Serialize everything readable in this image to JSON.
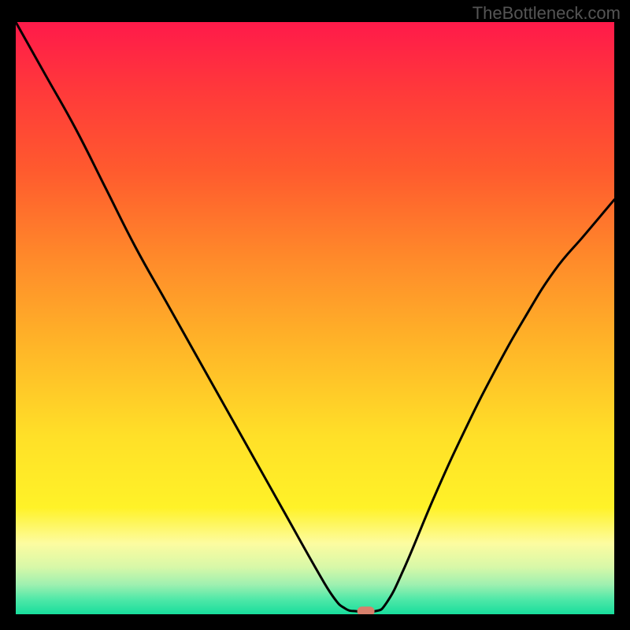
{
  "watermark": "TheBottleneck.com",
  "chart_data": {
    "type": "line",
    "title": "",
    "xlabel": "",
    "ylabel": "",
    "xlim": [
      0,
      100
    ],
    "ylim": [
      0,
      100
    ],
    "curve": [
      {
        "x": 0,
        "y": 100
      },
      {
        "x": 5,
        "y": 91
      },
      {
        "x": 10,
        "y": 82
      },
      {
        "x": 15,
        "y": 72
      },
      {
        "x": 20,
        "y": 62
      },
      {
        "x": 25,
        "y": 53
      },
      {
        "x": 30,
        "y": 44
      },
      {
        "x": 35,
        "y": 35
      },
      {
        "x": 40,
        "y": 26
      },
      {
        "x": 45,
        "y": 17
      },
      {
        "x": 50,
        "y": 8
      },
      {
        "x": 53,
        "y": 3
      },
      {
        "x": 55,
        "y": 1
      },
      {
        "x": 57,
        "y": 0.5
      },
      {
        "x": 60,
        "y": 0.5
      },
      {
        "x": 62,
        "y": 2
      },
      {
        "x": 65,
        "y": 8
      },
      {
        "x": 70,
        "y": 20
      },
      {
        "x": 75,
        "y": 31
      },
      {
        "x": 80,
        "y": 41
      },
      {
        "x": 85,
        "y": 50
      },
      {
        "x": 90,
        "y": 58
      },
      {
        "x": 95,
        "y": 64
      },
      {
        "x": 100,
        "y": 70
      }
    ],
    "marker": {
      "x": 58.5,
      "y": 0.5,
      "color": "#d8806c"
    },
    "gradient_stops": [
      {
        "offset": 0.0,
        "color": "#ff1a4a"
      },
      {
        "offset": 0.12,
        "color": "#ff3a3a"
      },
      {
        "offset": 0.25,
        "color": "#ff5a2e"
      },
      {
        "offset": 0.4,
        "color": "#ff8a2a"
      },
      {
        "offset": 0.55,
        "color": "#ffb628"
      },
      {
        "offset": 0.7,
        "color": "#ffe028"
      },
      {
        "offset": 0.82,
        "color": "#fff228"
      },
      {
        "offset": 0.88,
        "color": "#fdfca0"
      },
      {
        "offset": 0.92,
        "color": "#d8f8a8"
      },
      {
        "offset": 0.95,
        "color": "#9ef0b0"
      },
      {
        "offset": 0.975,
        "color": "#4fe8a8"
      },
      {
        "offset": 1.0,
        "color": "#18dd9c"
      }
    ]
  }
}
